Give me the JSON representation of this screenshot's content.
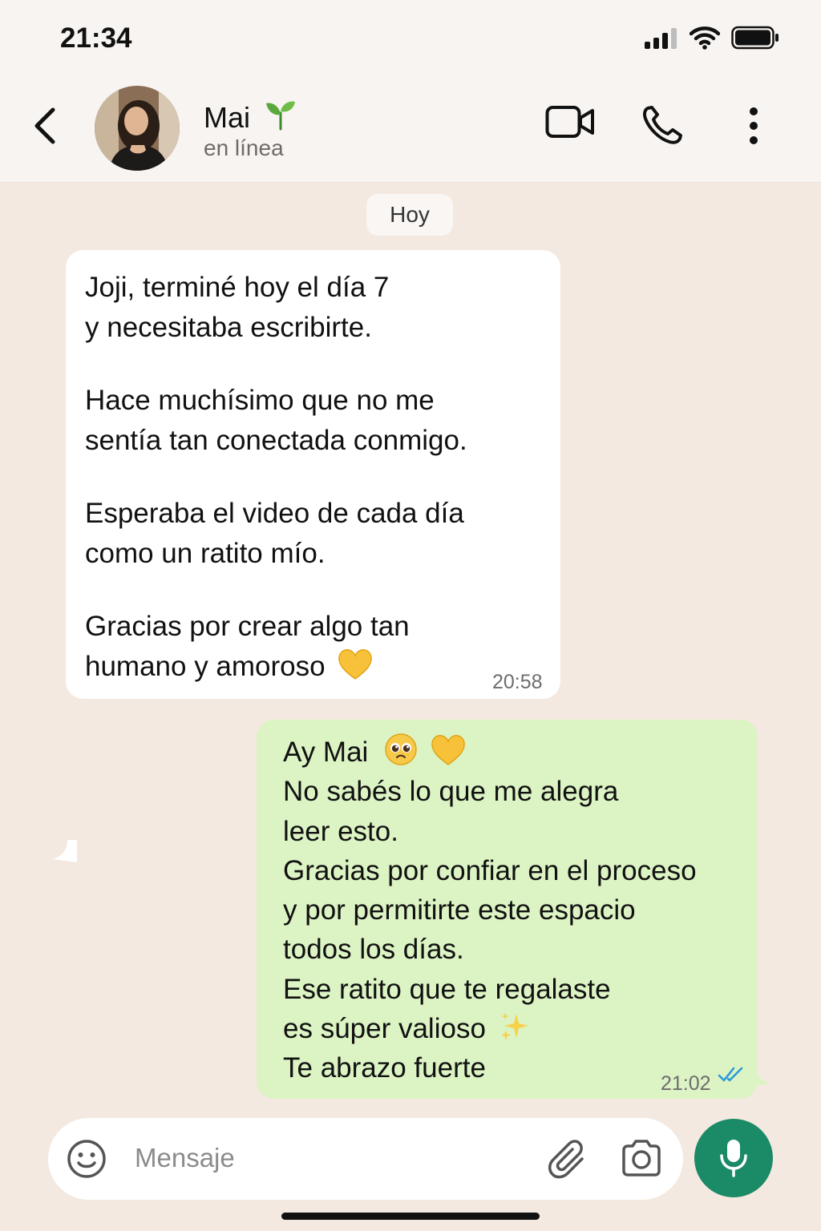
{
  "status_bar": {
    "time": "21:34"
  },
  "header": {
    "name": "Mai",
    "name_emoji": "seedling-icon",
    "status": "en línea"
  },
  "chat": {
    "date_chip": "Hoy",
    "incoming": {
      "paragraphs": [
        [
          "Joji, terminé hoy el día 7",
          "y necesitaba escribirte."
        ],
        [
          "Hace muchísimo que no me",
          "sentía tan conectada conmigo."
        ],
        [
          "Esperaba el video de cada día",
          "como un ratito mío."
        ],
        [
          "Gracias por crear algo tan",
          "humano y amoroso"
        ]
      ],
      "time": "20:58"
    },
    "outgoing": {
      "lines": [
        "Ay Mai",
        "No sabés lo que me alegra",
        "leer esto.",
        "Gracias por confiar en el proceso",
        "y por permitirte este espacio",
        "todos los días.",
        "Ese ratito que te regalaste",
        "es súper valioso",
        "Te abrazo fuerte"
      ],
      "time": "21:02",
      "status": "read"
    }
  },
  "composer": {
    "placeholder": "Mensaje"
  },
  "colors": {
    "accent": "#1b8a66",
    "outgoing_bubble": "#dcf3c4",
    "incoming_bubble": "#ffffff",
    "background": "#f3e9e0",
    "read_ticks": "#2a9bd8"
  }
}
